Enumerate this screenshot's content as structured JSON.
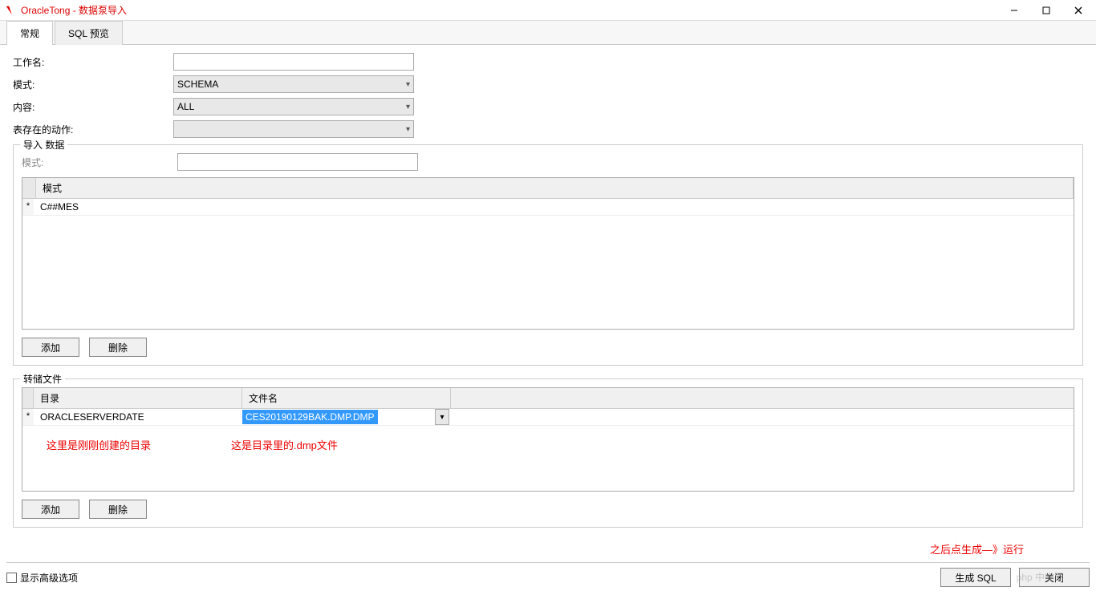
{
  "window": {
    "title": "OracleTong - 数据泵导入"
  },
  "tabs": {
    "general": "常规",
    "sql_preview": "SQL 预览"
  },
  "form": {
    "job_name_label": "工作名:",
    "job_name_value": "",
    "mode_label": "模式:",
    "mode_value": "SCHEMA",
    "content_label": "内容:",
    "content_value": "ALL",
    "table_action_label": "表存在的动作:",
    "table_action_value": ""
  },
  "import_section": {
    "legend": "导入 数据",
    "mode_label": "模式:",
    "mode_value": "",
    "table_header_mode": "模式",
    "rows": [
      {
        "marker": "*",
        "value": "C##MES"
      }
    ],
    "add_btn": "添加",
    "delete_btn": "删除"
  },
  "dump_section": {
    "legend": "转储文件",
    "header_dir": "目录",
    "header_file": "文件名",
    "rows": [
      {
        "marker": "*",
        "dir": "ORACLESERVERDATE",
        "file": "CES20190129BAK.DMP.DMP"
      }
    ],
    "annotation_dir": "这里是刚刚创建的目录",
    "annotation_file": "这是目录里的.dmp文件",
    "add_btn": "添加",
    "delete_btn": "删除"
  },
  "annotations": {
    "run_hint": "之后点生成—》运行"
  },
  "footer": {
    "advanced_checkbox": "显示高级选项",
    "generate_sql": "生成 SQL",
    "close": "关闭"
  },
  "watermark": {
    "text": "php 中文网"
  }
}
